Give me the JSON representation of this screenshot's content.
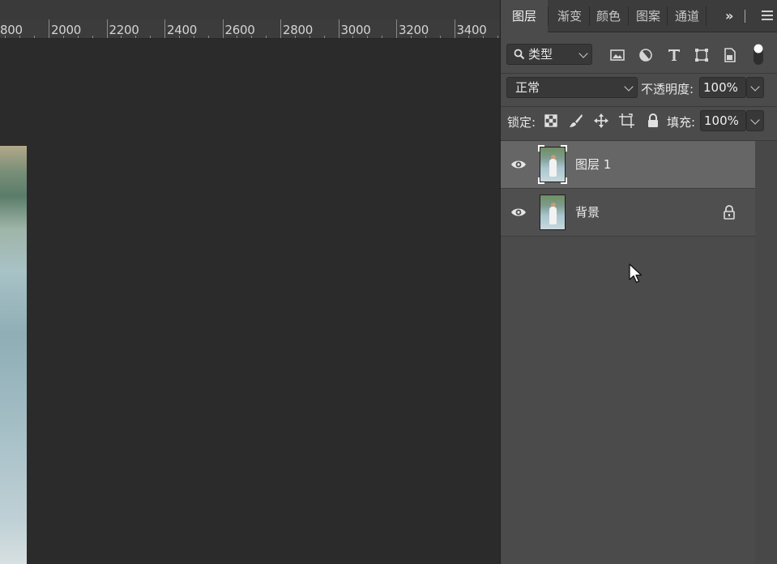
{
  "ruler": {
    "labels": [
      "800",
      "2000",
      "2200",
      "2400",
      "2600",
      "2800",
      "3000",
      "3200",
      "3400"
    ]
  },
  "panel": {
    "tabs": [
      {
        "label": "图层",
        "active": true
      },
      {
        "label": "渐变",
        "active": false
      },
      {
        "label": "颜色",
        "active": false
      },
      {
        "label": "图案",
        "active": false
      },
      {
        "label": "通道",
        "active": false
      }
    ],
    "more_label": "»",
    "filter": {
      "kind_label": "类型",
      "icons": [
        "image-filter-icon",
        "adjustment-filter-icon",
        "text-filter-icon",
        "shape-filter-icon",
        "smart-object-filter-icon",
        "filter-toggle-icon"
      ]
    },
    "blend": {
      "mode": "正常",
      "opacity_label": "不透明度:",
      "opacity_value": "100%"
    },
    "lock": {
      "label": "锁定:",
      "icons": [
        "lock-transparent-icon",
        "lock-image-icon",
        "lock-position-icon",
        "lock-artboard-icon",
        "lock-all-icon"
      ],
      "fill_label": "填充:",
      "fill_value": "100%"
    },
    "layers": [
      {
        "name": "图层 1",
        "visible": true,
        "selected": true,
        "locked": false
      },
      {
        "name": "背景",
        "visible": true,
        "selected": false,
        "locked": true
      }
    ]
  },
  "colors": {
    "panel_bg": "#4b4b4b",
    "canvas_bg": "#2b2b2b",
    "selected_layer": "#666666"
  }
}
